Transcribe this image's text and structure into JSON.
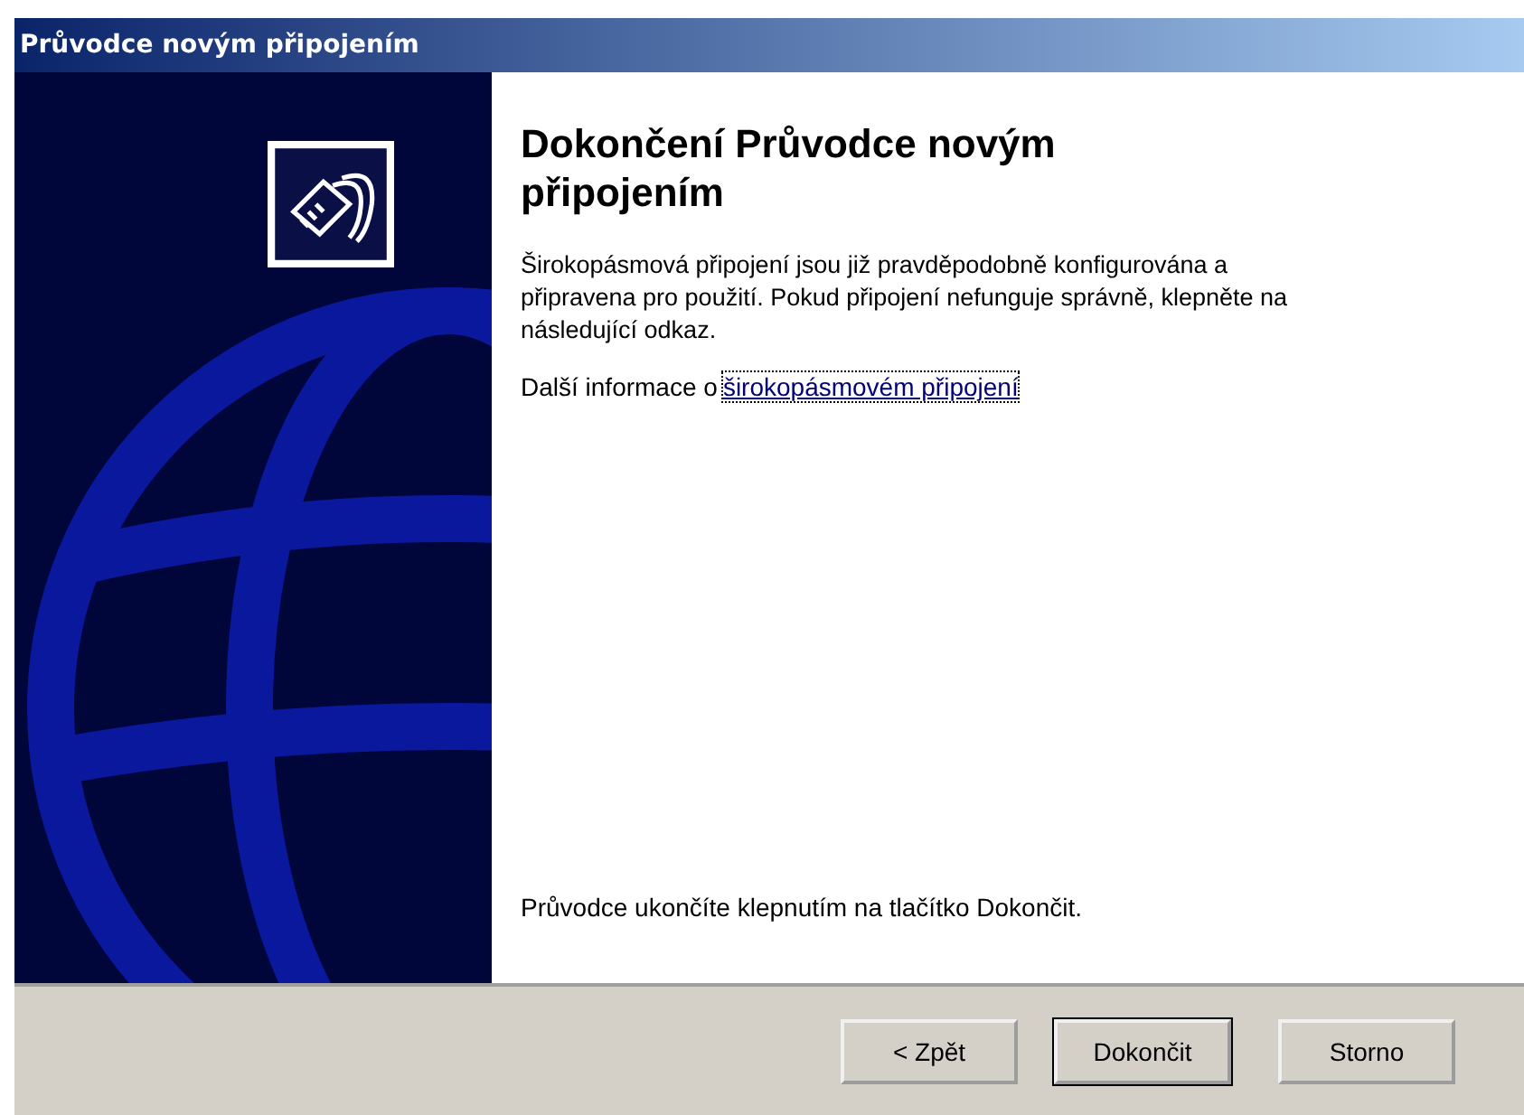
{
  "window": {
    "title": "Průvodce novým připojením"
  },
  "heading": "Dokončení Průvodce novým připojením",
  "description": "Širokopásmová připojení jsou již pravděpodobně konfigurována a připravena pro použití. Pokud připojení nefunguje správně, klepněte na následující odkaz.",
  "info": {
    "text": "Další informace o",
    "link": "širokopásmovém připojení"
  },
  "footer_text": "Průvodce ukončíte klepnutím na tlačítko Dokončit.",
  "buttons": [
    {
      "label": "< Zpět",
      "default": false
    },
    {
      "label": "Dokončit",
      "default": true
    },
    {
      "label": "Storno",
      "default": false
    }
  ]
}
